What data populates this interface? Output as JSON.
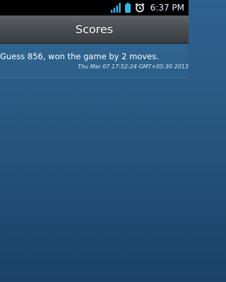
{
  "status_bar": {
    "time": "6:37 PM",
    "icons": [
      "signal-icon",
      "battery-icon",
      "alarm-icon"
    ]
  },
  "header": {
    "title": "Scores"
  },
  "scores": [
    {
      "text": "Guess 856, won the game by 2 moves.",
      "timestamp": "Thu Mar 07 17:52:24 GMT+05:30 2013"
    }
  ],
  "colors": {
    "status_bar": "#000000",
    "title_bar": "#4a4e52",
    "background": "#285a85"
  }
}
